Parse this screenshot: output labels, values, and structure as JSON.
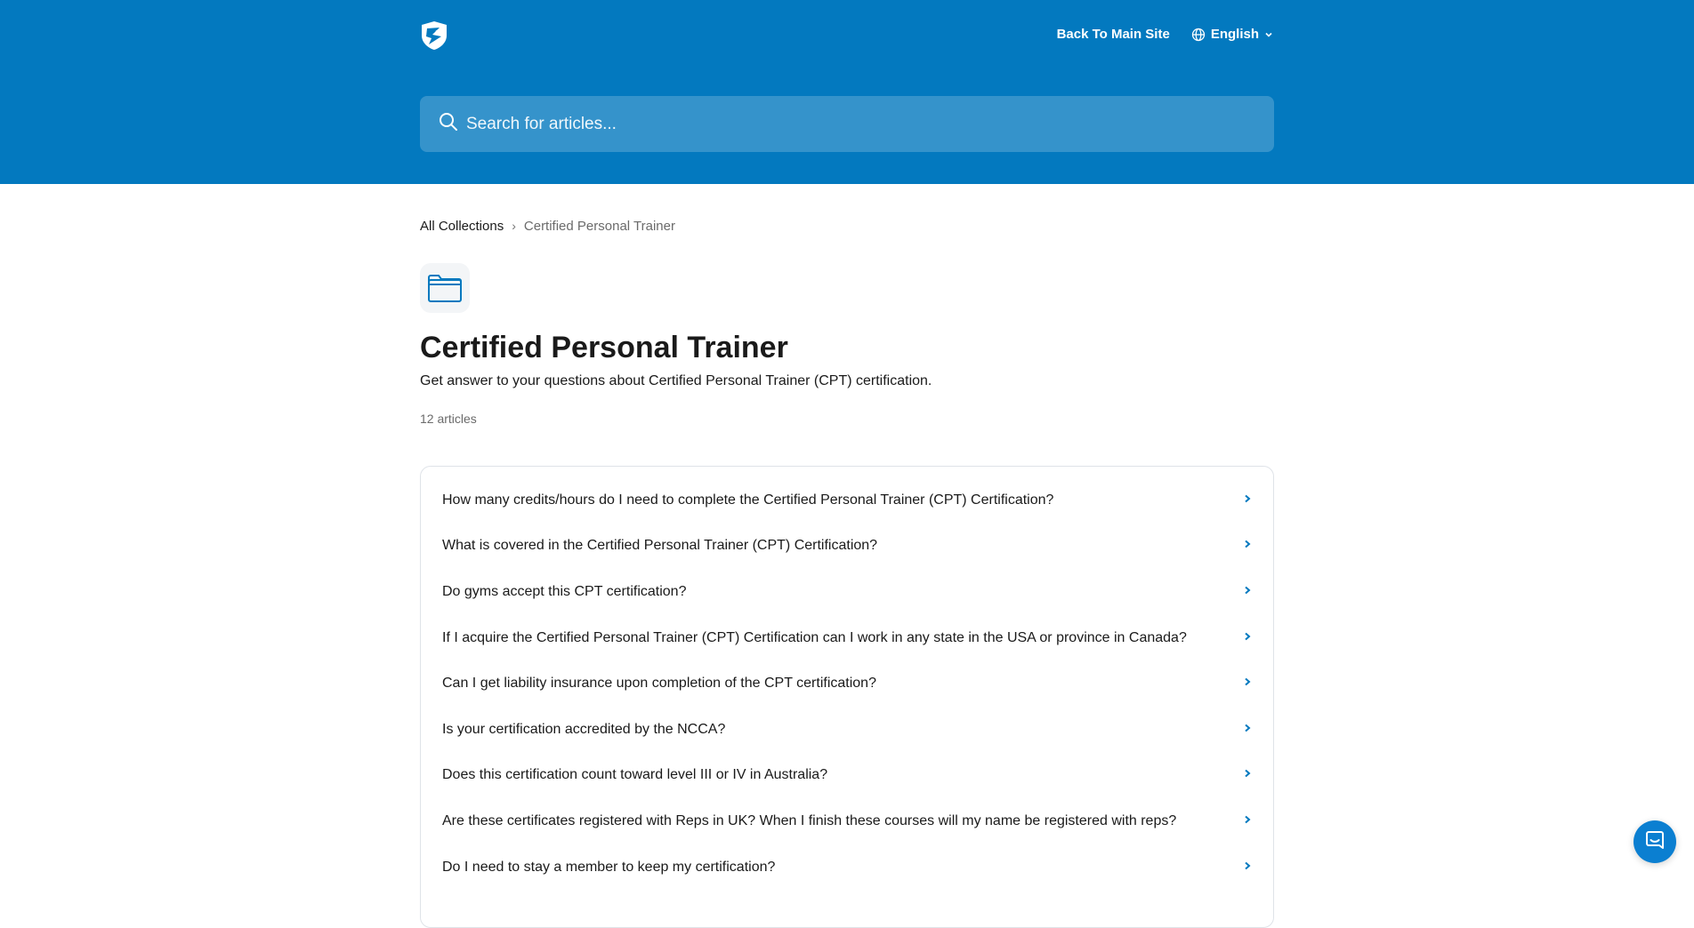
{
  "header": {
    "logo_icon": "shield-logo-icon",
    "back_link": "Back To Main Site",
    "language": "English",
    "background_color": "#0379bf"
  },
  "search": {
    "placeholder": "Search for articles..."
  },
  "breadcrumb": {
    "root": "All Collections",
    "separator": "›",
    "current": "Certified Personal Trainer"
  },
  "collection": {
    "icon": "folder-icon",
    "title": "Certified Personal Trainer",
    "description": "Get answer to your questions about Certified Personal Trainer (CPT) certification.",
    "count": "12 articles"
  },
  "articles": [
    {
      "title": "How many credits/hours do I need to complete the Certified Personal Trainer (CPT) Certification?"
    },
    {
      "title": "What is covered in the Certified Personal Trainer (CPT) Certification?"
    },
    {
      "title": "Do gyms accept this CPT certification?"
    },
    {
      "title": "If I acquire the Certified Personal Trainer (CPT) Certification can I work in any state in the USA or province in Canada?"
    },
    {
      "title": "Can I get liability insurance upon completion of the CPT certification?"
    },
    {
      "title": "Is your certification accredited by the NCCA?"
    },
    {
      "title": "Does this certification count toward level III or IV in Australia?"
    },
    {
      "title": "Are these certificates registered with Reps in UK? When I finish these courses will my name be registered with reps?"
    },
    {
      "title": "Do I need to stay a member to keep my certification?"
    }
  ],
  "accent_color": "#0379bf",
  "messenger_icon": "chat-bubble-icon"
}
